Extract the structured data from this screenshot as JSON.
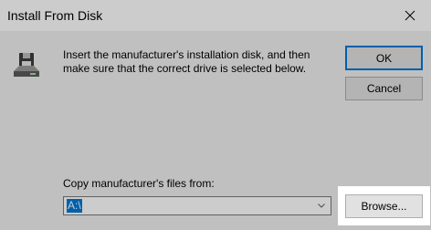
{
  "dialog": {
    "title": "Install From Disk",
    "message": "Insert the manufacturer's installation disk, and then make sure that the correct drive is selected below.",
    "ok_label": "OK",
    "cancel_label": "Cancel",
    "copy_label": "Copy manufacturer's files from:",
    "path_value": "A:\\",
    "browse_label": "Browse...",
    "icon": "floppy-disk-drive-icon"
  },
  "colors": {
    "accent": "#0078d7",
    "dialog_bg": "#f0f0f0",
    "button_bg": "#e1e1e1"
  }
}
